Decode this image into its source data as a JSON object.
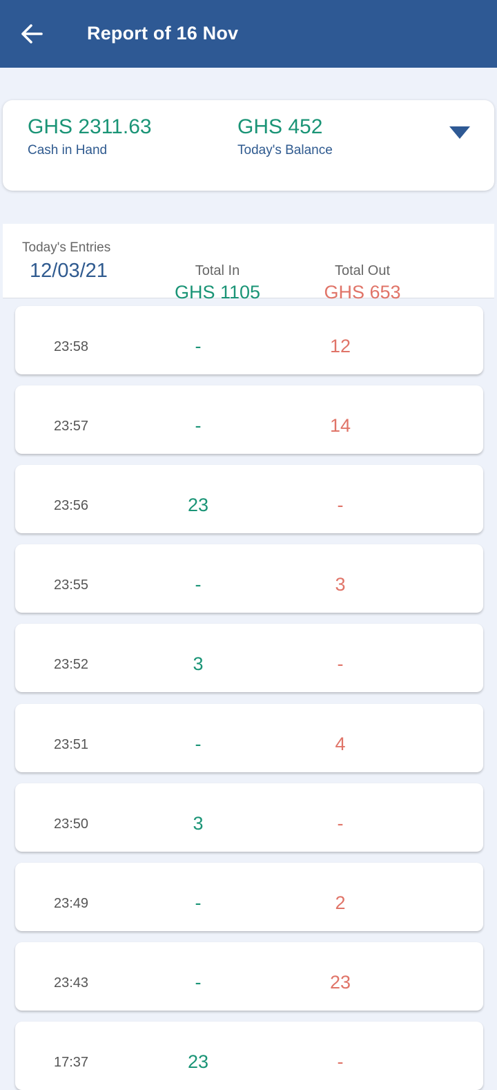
{
  "appbar": {
    "title": "Report of 16 Nov",
    "back_icon": "arrow-left-icon"
  },
  "summary": {
    "cash_in_hand": {
      "amount": "GHS 2311.63",
      "label": "Cash in Hand"
    },
    "todays_balance": {
      "amount": "GHS 452",
      "label": "Today's Balance"
    },
    "expand_icon": "caret-down-icon"
  },
  "entries_header": {
    "caption": "Today's Entries",
    "date": "12/03/21",
    "total_in_label": "Total In",
    "total_in_value": "GHS 1105",
    "total_out_label": "Total Out",
    "total_out_value": "GHS 653"
  },
  "entries": [
    {
      "time": "23:58",
      "in": "-",
      "out": "12"
    },
    {
      "time": "23:57",
      "in": "-",
      "out": "14"
    },
    {
      "time": "23:56",
      "in": "23",
      "out": "-"
    },
    {
      "time": "23:55",
      "in": "-",
      "out": "3"
    },
    {
      "time": "23:52",
      "in": "3",
      "out": "-"
    },
    {
      "time": "23:51",
      "in": "-",
      "out": "4"
    },
    {
      "time": "23:50",
      "in": "3",
      "out": "-"
    },
    {
      "time": "23:49",
      "in": "-",
      "out": "2"
    },
    {
      "time": "23:43",
      "in": "-",
      "out": "23"
    },
    {
      "time": "17:37",
      "in": "23",
      "out": "-"
    }
  ],
  "colors": {
    "primary": "#2e5994",
    "in": "#1a9476",
    "out": "#e07468",
    "background": "#eef2fa"
  }
}
